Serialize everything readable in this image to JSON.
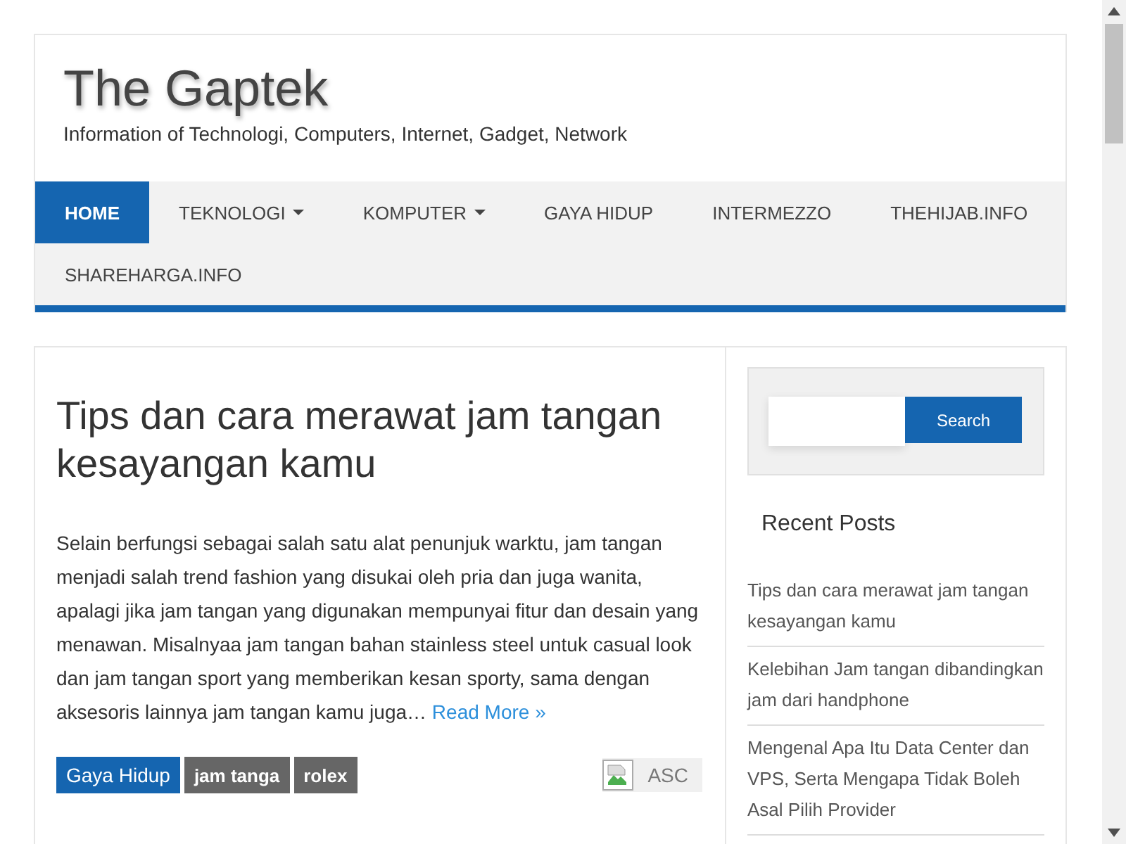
{
  "site": {
    "title": "The Gaptek",
    "tagline": "Information of Technologi, Computers, Internet, Gadget, Network"
  },
  "nav": [
    {
      "label": "HOME",
      "selected": true,
      "has_dropdown": false
    },
    {
      "label": "TEKNOLOGI",
      "selected": false,
      "has_dropdown": true
    },
    {
      "label": "KOMPUTER",
      "selected": false,
      "has_dropdown": true
    },
    {
      "label": "GAYA HIDUP",
      "selected": false,
      "has_dropdown": false
    },
    {
      "label": "INTERMEZZO",
      "selected": false,
      "has_dropdown": false
    },
    {
      "label": "THEHIJAB.INFO",
      "selected": false,
      "has_dropdown": false
    },
    {
      "label": "SHAREHARGA.INFO",
      "selected": false,
      "has_dropdown": false
    }
  ],
  "post": {
    "title": "Tips dan cara merawat jam tangan kesayangan kamu",
    "excerpt": "Selain berfungsi sebagai salah satu alat penunjuk warktu, jam tangan menjadi salah trend fashion yang disukai oleh pria dan juga wanita, apalagi  jika jam tangan yang digunakan mempunyai fitur dan desain yang menawan. Misalnyaa jam tangan bahan stainless steel  untuk casual look dan jam tangan sport yang memberikan kesan sporty, sama dengan aksesoris lainnya jam tangan kamu juga…",
    "read_more": "Read More »",
    "tags": [
      {
        "label": "Gaya Hidup",
        "kind": "category"
      },
      {
        "label": "jam tanga",
        "kind": "tag"
      },
      {
        "label": "rolex",
        "kind": "tag"
      }
    ],
    "badge": "ASC"
  },
  "sidebar": {
    "search_button": "Search",
    "recent_title": "Recent Posts",
    "recent_posts": [
      "Tips dan cara merawat jam tangan kesayangan kamu",
      "Kelebihan Jam tangan dibandingkan jam dari handphone",
      "Mengenal Apa Itu Data Center dan VPS, Serta Mengapa Tidak Boleh Asal Pilih Provider"
    ]
  }
}
